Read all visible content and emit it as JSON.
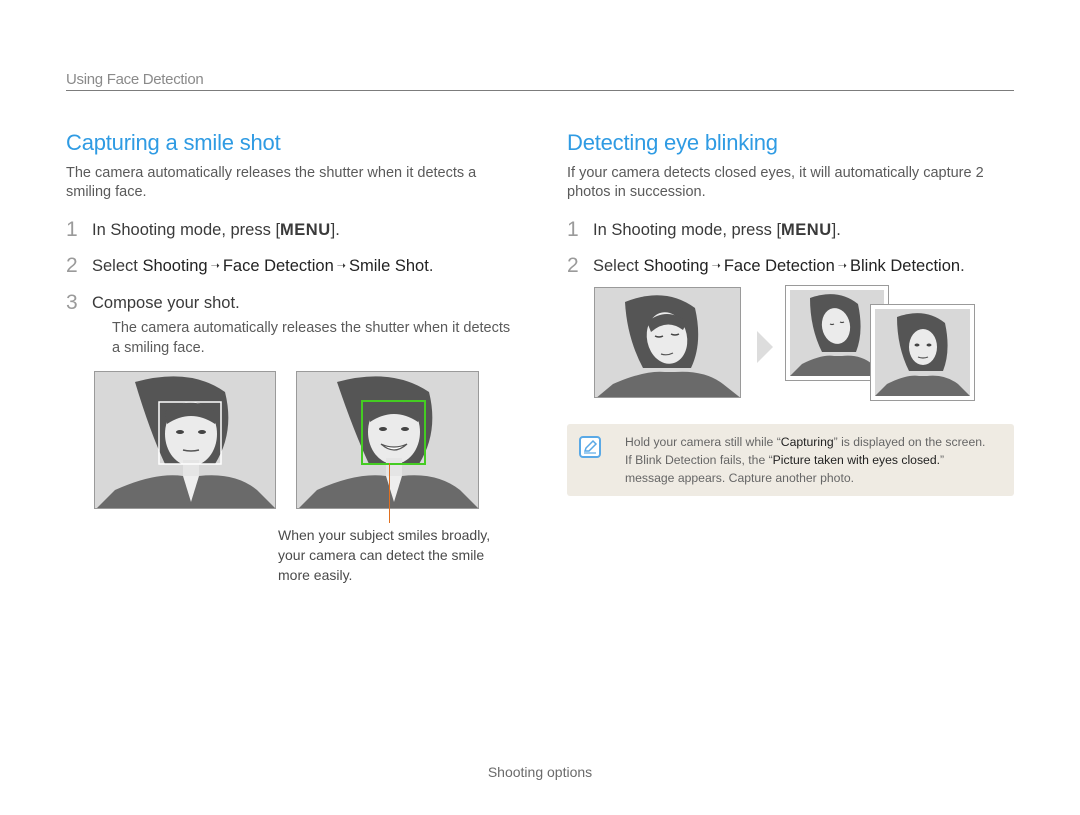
{
  "header": {
    "section": "Using Face Detection"
  },
  "left": {
    "title": "Capturing a smile shot",
    "intro": "The camera automatically releases the shutter when it detects a smiling face.",
    "steps": [
      {
        "num": "1",
        "prefix": "In Shooting mode, press [",
        "key": "MENU",
        "suffix": "]."
      },
      {
        "num": "2",
        "prefix": "Select ",
        "path": [
          "Shooting",
          "Face Detection",
          "Smile Shot"
        ],
        "suffix": "."
      },
      {
        "num": "3",
        "text": "Compose your shot."
      }
    ],
    "step3_note": "The camera automatically releases the shutter when it detects a smiling face.",
    "caption": "When your subject smiles broadly, your camera can detect the smile more easily."
  },
  "right": {
    "title": "Detecting eye blinking",
    "intro": "If your camera detects closed eyes, it will automatically capture 2 photos in succession.",
    "steps": [
      {
        "num": "1",
        "prefix": "In Shooting mode, press [",
        "key": "MENU",
        "suffix": "]."
      },
      {
        "num": "2",
        "prefix": "Select ",
        "path": [
          "Shooting",
          "Face Detection",
          "Blink Detection"
        ],
        "suffix": "."
      }
    ]
  },
  "note": {
    "line1_pre": "Hold your camera still while “",
    "line1_kw": "Capturing",
    "line1_post": "” is displayed on the screen.",
    "line2_pre": "If Blink Detection fails, the “",
    "line2_kw": "Picture taken with eyes closed.",
    "line2_post": "”",
    "line3": "message appears. Capture another photo."
  },
  "footer": {
    "text": "Shooting options"
  },
  "colors": {
    "title_blue": "#2f9be3",
    "face_box_green": "#44cc22",
    "callout_orange": "#e07020",
    "note_bg": "#efebe3"
  }
}
